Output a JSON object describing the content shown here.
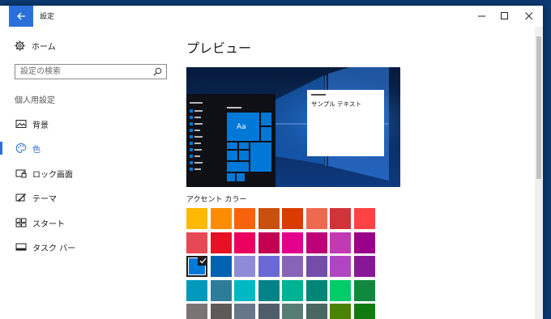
{
  "window": {
    "title": "設定",
    "controls": [
      "minimize-icon",
      "maximize-icon",
      "close-icon"
    ]
  },
  "sidebar": {
    "home_label": "ホーム",
    "search_placeholder": "設定の検索",
    "group_header": "個人用設定",
    "items": [
      {
        "label": "背景",
        "icon": "picture-icon",
        "selected": false
      },
      {
        "label": "色",
        "icon": "palette-icon",
        "selected": true
      },
      {
        "label": "ロック画面",
        "icon": "lock-screen-icon",
        "selected": false
      },
      {
        "label": "テーマ",
        "icon": "theme-brush-icon",
        "selected": false
      },
      {
        "label": "スタート",
        "icon": "start-tiles-icon",
        "selected": false
      },
      {
        "label": "タスク バー",
        "icon": "taskbar-icon",
        "selected": false
      }
    ]
  },
  "content": {
    "preview_title": "プレビュー",
    "preview": {
      "tile_text": "Aa",
      "window_text": "サンプル テキスト"
    },
    "accent_label": "アクセント カラー",
    "selected_swatch_index": 16,
    "swatches": [
      "#ffb900",
      "#ff8c00",
      "#f7630c",
      "#ca5010",
      "#da3b01",
      "#ef6950",
      "#d13438",
      "#ff4343",
      "#e74856",
      "#e81123",
      "#ea005e",
      "#c30052",
      "#e3008c",
      "#bf0077",
      "#c239b3",
      "#9a0089",
      "#0078d7",
      "#0063b1",
      "#8e8cd8",
      "#6b69d6",
      "#8764b8",
      "#744da9",
      "#b146c2",
      "#881798",
      "#0099bc",
      "#2d7d9a",
      "#00b7c3",
      "#038387",
      "#00b294",
      "#018574",
      "#00cc6a",
      "#10893e",
      "#7a7574",
      "#5d5a58",
      "#68768a",
      "#515c6b",
      "#567c73",
      "#486860",
      "#498205",
      "#107c10"
    ]
  }
}
